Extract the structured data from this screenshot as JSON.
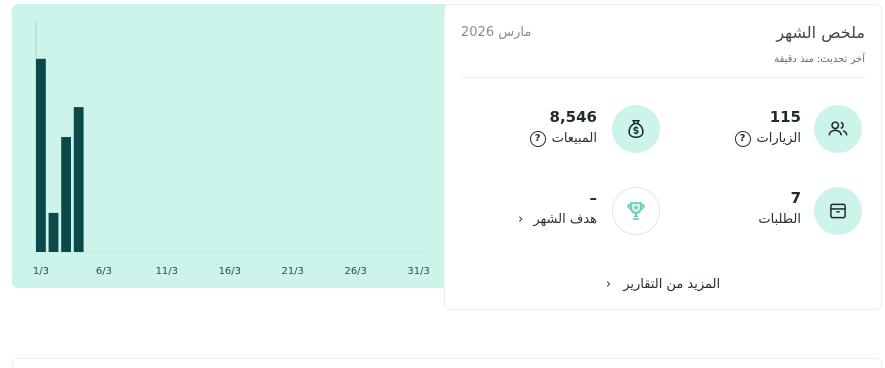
{
  "summary": {
    "title": "ملخص الشهر",
    "subtitle": "آخر تحديث: منذ دقيقة",
    "date": "مارس 2026",
    "more_link": "المزيد من التقارير",
    "stats": {
      "visits": {
        "value": "115",
        "label": "الزيارات",
        "icon": "users-icon"
      },
      "sales": {
        "value": "8,546",
        "label": "المبيعات",
        "icon": "money-bag-icon"
      },
      "orders": {
        "value": "7",
        "label": "الطلبات",
        "icon": "box-icon"
      },
      "goal": {
        "value": "–",
        "label": "هدف الشهر",
        "icon": "trophy-icon"
      }
    }
  },
  "colors": {
    "accent_bg": "#cdf4ea",
    "bar": "#0b4a4a",
    "text_dark": "#1f2a2e"
  },
  "chart_data": {
    "type": "bar",
    "x_ticks": [
      "1/3",
      "6/3",
      "11/3",
      "16/3",
      "21/3",
      "26/3",
      "31/3"
    ],
    "categories": [
      "1/3",
      "2/3",
      "3/3",
      "4/3"
    ],
    "values": [
      84,
      17,
      50,
      63
    ],
    "ylim": [
      0,
      100
    ],
    "grid": false
  }
}
